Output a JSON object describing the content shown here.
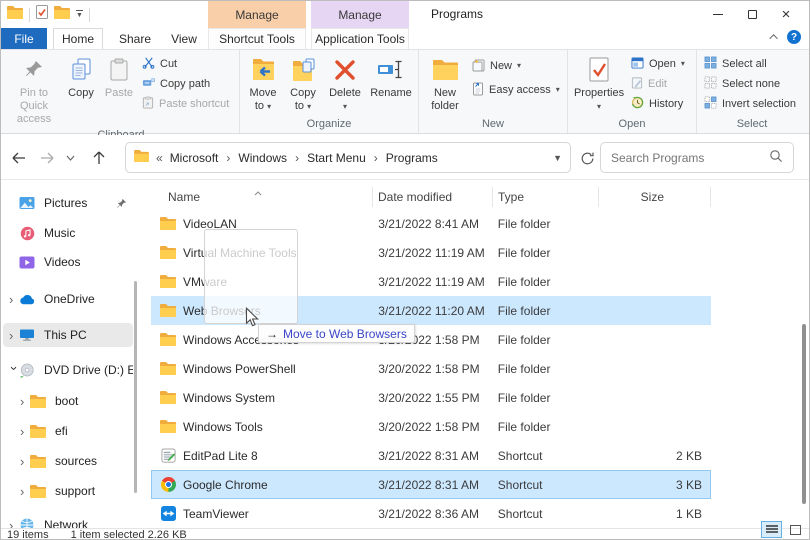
{
  "window": {
    "title": "Programs"
  },
  "context_tabs": [
    {
      "manage": "Manage",
      "tool": "Shortcut Tools",
      "color": "#f8cfa8"
    },
    {
      "manage": "Manage",
      "tool": "Application Tools",
      "color": "#e6d5f3"
    }
  ],
  "tabs": {
    "file": "File",
    "home": "Home",
    "share": "Share",
    "view": "View"
  },
  "ribbon": {
    "clipboard": {
      "group": "Clipboard",
      "pin_line1": "Pin to Quick",
      "pin_line2": "access",
      "copy": "Copy",
      "paste": "Paste",
      "cut": "Cut",
      "copy_path": "Copy path",
      "paste_shortcut": "Paste shortcut"
    },
    "organize": {
      "group": "Organize",
      "move_line1": "Move",
      "move_line2": "to",
      "copy_line1": "Copy",
      "copy_line2": "to",
      "delete": "Delete",
      "rename": "Rename"
    },
    "new": {
      "group": "New",
      "new_folder_line1": "New",
      "new_folder_line2": "folder",
      "new_item": "New",
      "easy_access": "Easy access"
    },
    "open": {
      "group": "Open",
      "properties": "Properties",
      "open": "Open",
      "edit": "Edit",
      "history": "History"
    },
    "select": {
      "group": "Select",
      "select_all": "Select all",
      "select_none": "Select none",
      "invert_selection": "Invert selection"
    }
  },
  "address": {
    "overflow": "«",
    "crumbs": [
      "Microsoft",
      "Windows",
      "Start Menu",
      "Programs"
    ],
    "separator": "›",
    "search_placeholder": "Search Programs"
  },
  "sidebar": {
    "items": [
      {
        "label": "Pictures",
        "icon": "pictures",
        "chevron": "none",
        "level": 0,
        "pinned": true
      },
      {
        "label": "Music",
        "icon": "music",
        "chevron": "none",
        "level": 0
      },
      {
        "label": "Videos",
        "icon": "videos",
        "chevron": "none",
        "level": 0
      },
      {
        "label": "OneDrive",
        "icon": "onedrive",
        "chevron": "collapsed",
        "level": 0
      },
      {
        "label": "This PC",
        "icon": "this-pc",
        "chevron": "collapsed",
        "level": 0,
        "selected": true
      },
      {
        "label": "DVD Drive (D:) ES",
        "icon": "dvd-drive",
        "chevron": "expanded",
        "level": 0
      },
      {
        "label": "boot",
        "icon": "folder",
        "chevron": "collapsed",
        "level": 1
      },
      {
        "label": "efi",
        "icon": "folder",
        "chevron": "collapsed",
        "level": 1
      },
      {
        "label": "sources",
        "icon": "folder",
        "chevron": "collapsed",
        "level": 1
      },
      {
        "label": "support",
        "icon": "folder",
        "chevron": "collapsed",
        "level": 1
      },
      {
        "label": "Network",
        "icon": "network",
        "chevron": "collapsed",
        "level": 0
      }
    ]
  },
  "list": {
    "columns": [
      "Name",
      "Date modified",
      "Type",
      "Size"
    ],
    "rows": [
      {
        "name": "VideoLAN",
        "date": "3/21/2022 8:41 AM",
        "type": "File folder",
        "size": "",
        "icon": "folder",
        "state": "normal"
      },
      {
        "name": "Virtual Machine Tools",
        "date": "3/21/2022 11:19 AM",
        "type": "File folder",
        "size": "",
        "icon": "folder",
        "state": "normal"
      },
      {
        "name": "VMware",
        "date": "3/21/2022 11:19 AM",
        "type": "File folder",
        "size": "",
        "icon": "folder",
        "state": "normal"
      },
      {
        "name": "Web Browsers",
        "date": "3/21/2022 11:20 AM",
        "type": "File folder",
        "size": "",
        "icon": "folder",
        "state": "droptarget"
      },
      {
        "name": "Windows Accessories",
        "date": "3/20/2022 1:58 PM",
        "type": "File folder",
        "size": "",
        "icon": "folder",
        "state": "normal"
      },
      {
        "name": "Windows PowerShell",
        "date": "3/20/2022 1:58 PM",
        "type": "File folder",
        "size": "",
        "icon": "folder",
        "state": "normal"
      },
      {
        "name": "Windows System",
        "date": "3/20/2022 1:55 PM",
        "type": "File folder",
        "size": "",
        "icon": "folder",
        "state": "normal"
      },
      {
        "name": "Windows Tools",
        "date": "3/20/2022 1:58 PM",
        "type": "File folder",
        "size": "",
        "icon": "folder",
        "state": "normal"
      },
      {
        "name": "EditPad Lite 8",
        "date": "3/21/2022 8:31 AM",
        "type": "Shortcut",
        "size": "2 KB",
        "icon": "editpad",
        "state": "normal"
      },
      {
        "name": "Google Chrome",
        "date": "3/21/2022 8:31 AM",
        "type": "Shortcut",
        "size": "3 KB",
        "icon": "chrome",
        "state": "selected"
      },
      {
        "name": "TeamViewer",
        "date": "3/21/2022 8:36 AM",
        "type": "Shortcut",
        "size": "1 KB",
        "icon": "teamviewer",
        "state": "normal"
      }
    ]
  },
  "drag": {
    "action_arrow": "→",
    "tooltip": "Move to Web Browsers"
  },
  "status": {
    "items_count": "19 items",
    "selection": "1 item selected 2.26 KB"
  },
  "colors": {
    "file_tab": "#1e6bbf",
    "manage_shortcut_tools": "#f8cfa8",
    "manage_application_tools": "#e6d5f3",
    "selection_fill": "#cce8ff",
    "selection_border": "#93c9f0",
    "drop_tooltip_text": "#3a45c8",
    "delete_icon": "#e0502f",
    "folder_yellow": "#ffce4f"
  },
  "icons": {
    "back": "←",
    "forward": "→",
    "up": "↑",
    "dropdown": "▾",
    "refresh": "refresh-arrow",
    "search": "magnifier",
    "help": "?",
    "sort": "ascending-chevron"
  }
}
